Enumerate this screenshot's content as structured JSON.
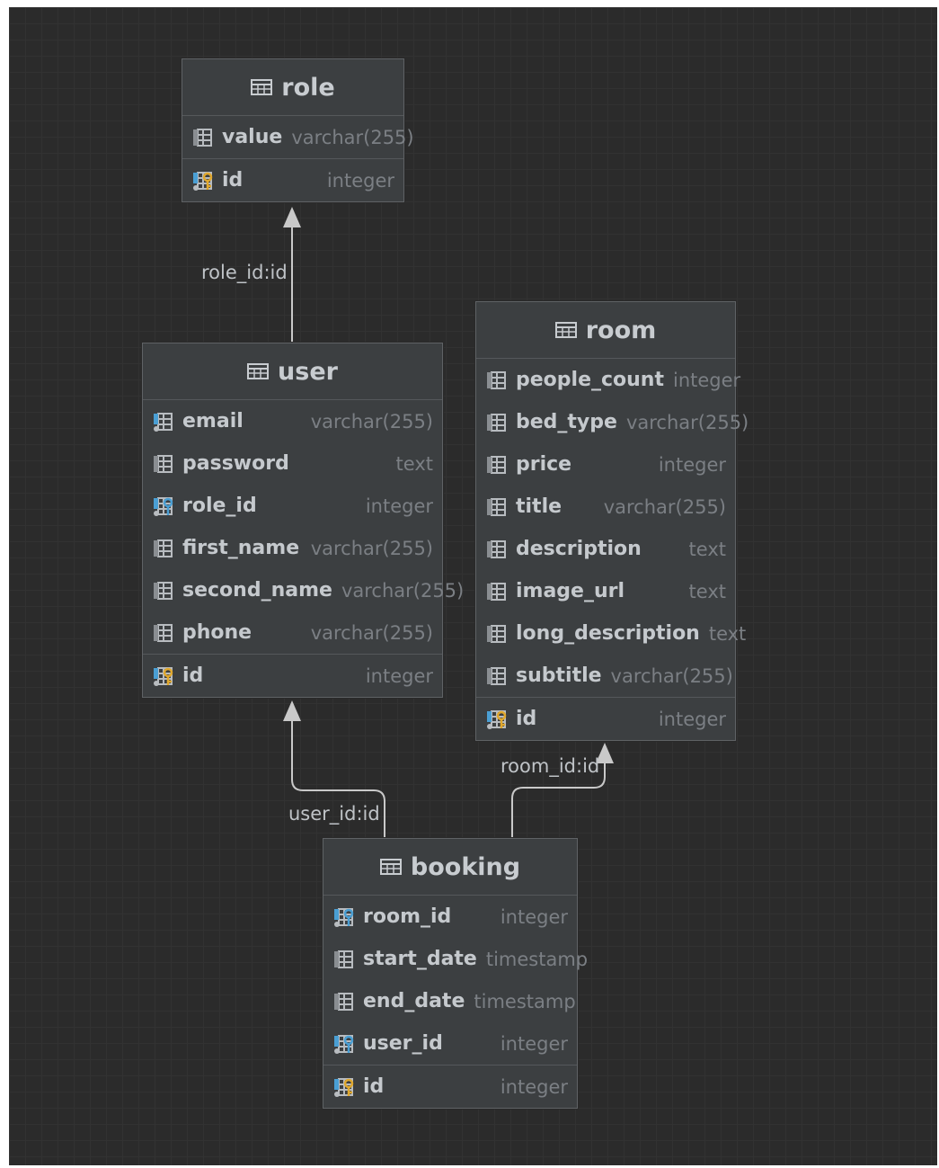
{
  "tables": {
    "role": {
      "name": "role",
      "columns": [
        {
          "name": "value",
          "type": "varchar(255)",
          "icon": "column-icon"
        }
      ],
      "pk": {
        "name": "id",
        "type": "integer",
        "icon": "primary-key-icon"
      }
    },
    "user": {
      "name": "user",
      "columns": [
        {
          "name": "email",
          "type": "varchar(255)",
          "icon": "indexed-column-icon"
        },
        {
          "name": "password",
          "type": "text",
          "icon": "column-icon"
        },
        {
          "name": "role_id",
          "type": "integer",
          "icon": "foreign-key-icon"
        },
        {
          "name": "first_name",
          "type": "varchar(255)",
          "icon": "column-icon"
        },
        {
          "name": "second_name",
          "type": "varchar(255)",
          "icon": "column-icon"
        },
        {
          "name": "phone",
          "type": "varchar(255)",
          "icon": "column-icon"
        }
      ],
      "pk": {
        "name": "id",
        "type": "integer",
        "icon": "primary-key-icon"
      }
    },
    "room": {
      "name": "room",
      "columns": [
        {
          "name": "people_count",
          "type": "integer",
          "icon": "column-icon"
        },
        {
          "name": "bed_type",
          "type": "varchar(255)",
          "icon": "column-icon"
        },
        {
          "name": "price",
          "type": "integer",
          "icon": "column-icon"
        },
        {
          "name": "title",
          "type": "varchar(255)",
          "icon": "column-icon"
        },
        {
          "name": "description",
          "type": "text",
          "icon": "column-icon"
        },
        {
          "name": "image_url",
          "type": "text",
          "icon": "column-icon"
        },
        {
          "name": "long_description",
          "type": "text",
          "icon": "column-icon"
        },
        {
          "name": "subtitle",
          "type": "varchar(255)",
          "icon": "column-icon"
        }
      ],
      "pk": {
        "name": "id",
        "type": "integer",
        "icon": "primary-key-icon"
      }
    },
    "booking": {
      "name": "booking",
      "columns": [
        {
          "name": "room_id",
          "type": "integer",
          "icon": "foreign-key-icon"
        },
        {
          "name": "start_date",
          "type": "timestamp",
          "icon": "column-icon"
        },
        {
          "name": "end_date",
          "type": "timestamp",
          "icon": "column-icon"
        },
        {
          "name": "user_id",
          "type": "integer",
          "icon": "foreign-key-icon"
        }
      ],
      "pk": {
        "name": "id",
        "type": "integer",
        "icon": "primary-key-icon"
      }
    }
  },
  "relations": [
    {
      "label": "role_id:id",
      "from": "user",
      "to": "role"
    },
    {
      "label": "user_id:id",
      "from": "booking",
      "to": "user"
    },
    {
      "label": "room_id:id",
      "from": "booking",
      "to": "room"
    }
  ],
  "colors": {
    "background": "#2b2b2b",
    "table": "#3c3f41",
    "key_gold": "#e0a82e",
    "index_blue": "#4a9fd4",
    "connector": "#c9c9c9"
  }
}
